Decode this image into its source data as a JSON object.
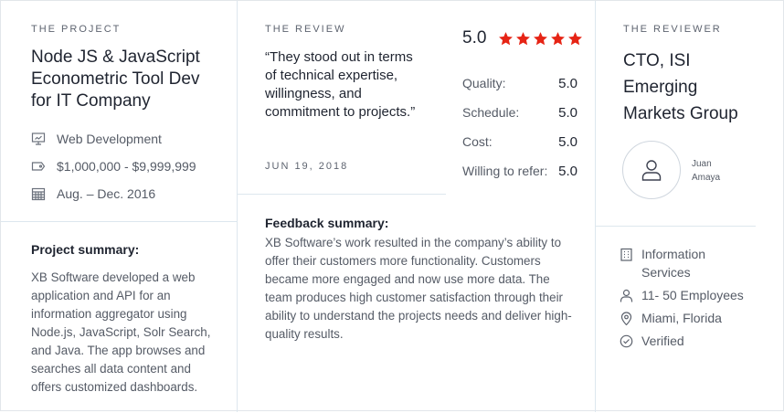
{
  "project": {
    "eyebrow": "THE PROJECT",
    "title": "Node JS & JavaScript Econometric Tool Dev for IT Company",
    "service": "Web Development",
    "budget": "$1,000,000 - $9,999,999",
    "dates": "Aug. – Dec. 2016",
    "summary_heading": "Project summary:",
    "summary": "XB Software developed a web application and API for an information aggregator using Node.js, JavaScript, Solr Search, and Java. The app browses and searches all data content and offers customized dashboards."
  },
  "review": {
    "eyebrow": "THE REVIEW",
    "quote": "“They stood out in terms of technical expertise, willingness, and commitment to projects.”",
    "date": "JUN 19, 2018",
    "overall": "5.0",
    "stars": 5,
    "star_color": "#e62415",
    "ratings": [
      {
        "label": "Quality:",
        "value": "5.0"
      },
      {
        "label": "Schedule:",
        "value": "5.0"
      },
      {
        "label": "Cost:",
        "value": "5.0"
      },
      {
        "label": "Willing to refer:",
        "value": "5.0"
      }
    ],
    "feedback_heading": "Feedback summary:",
    "feedback": "XB Software’s work resulted in the company’s ability to offer their customers more functionality. Customers became more engaged and now use more data. The team produces high customer satisfaction through their ability to understand the projects needs and deliver high-quality results."
  },
  "reviewer": {
    "eyebrow": "THE REVIEWER",
    "title": "CTO, ISI Emerging Markets Group",
    "name_first": "Juan",
    "name_last": "Amaya",
    "industry": "Information Services",
    "employees": "11- 50 Employees",
    "location": "Miami, Florida",
    "status": "Verified"
  }
}
